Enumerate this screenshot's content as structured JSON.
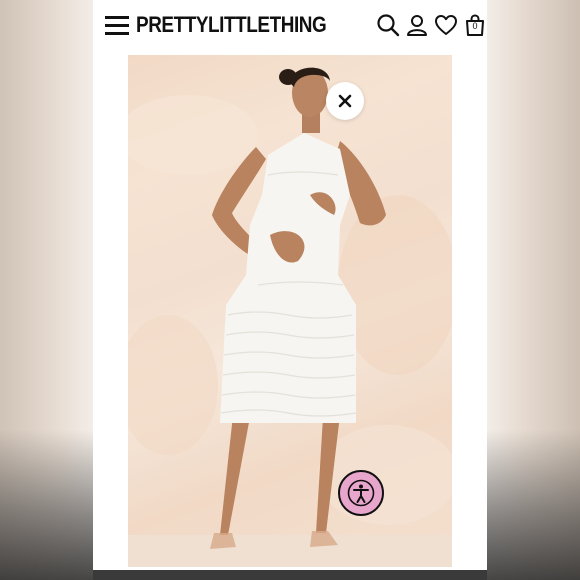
{
  "header": {
    "brand": "PRETTYLITTLETHING",
    "icons": [
      "menu-icon",
      "search-icon",
      "account-icon",
      "wishlist-icon",
      "bag-icon"
    ],
    "bag_count": "0"
  },
  "product_image": {
    "description_icon": "product-photo"
  },
  "overlay": {
    "close_icon": "close-icon",
    "accessibility_icon": "accessibility-icon",
    "accessibility_color": "#e9a6cc"
  },
  "colors": {
    "brand_text": "#111111",
    "background": "#ffffff"
  }
}
